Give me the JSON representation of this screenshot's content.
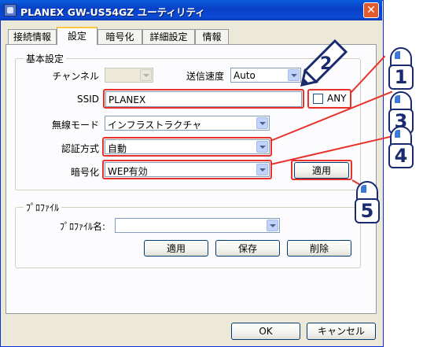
{
  "window": {
    "title": "PLANEX GW-US54GZ ユーティリティ",
    "close_label": "✕"
  },
  "tabs": [
    {
      "label": "接続情報",
      "active": false
    },
    {
      "label": "設定",
      "active": true
    },
    {
      "label": "暗号化",
      "active": false
    },
    {
      "label": "詳細設定",
      "active": false
    },
    {
      "label": "情報",
      "active": false
    }
  ],
  "basic": {
    "group_title": "基本設定",
    "channel_label": "チャンネル",
    "channel_value": "",
    "rate_label": "送信速度",
    "rate_value": "Auto",
    "ssid_label": "SSID",
    "ssid_value": "PLANEX",
    "any_label": "ANY",
    "mode_label": "無線モード",
    "mode_value": "インフラストラクチャ",
    "auth_label": "認証方式",
    "auth_value": "自動",
    "enc_label": "暗号化",
    "enc_value": "WEP有効",
    "apply_label": "適用"
  },
  "profile": {
    "group_title": "ﾌﾟﾛﾌｧｲﾙ",
    "name_label": "ﾌﾟﾛﾌｧｲﾙ名:",
    "name_value": "",
    "apply_label": "適用",
    "save_label": "保存",
    "delete_label": "削除"
  },
  "footer": {
    "ok_label": "OK",
    "cancel_label": "キャンセル"
  },
  "annotations": {
    "color": "#e8312a",
    "steps": [
      "1",
      "2",
      "3",
      "4",
      "5"
    ]
  }
}
